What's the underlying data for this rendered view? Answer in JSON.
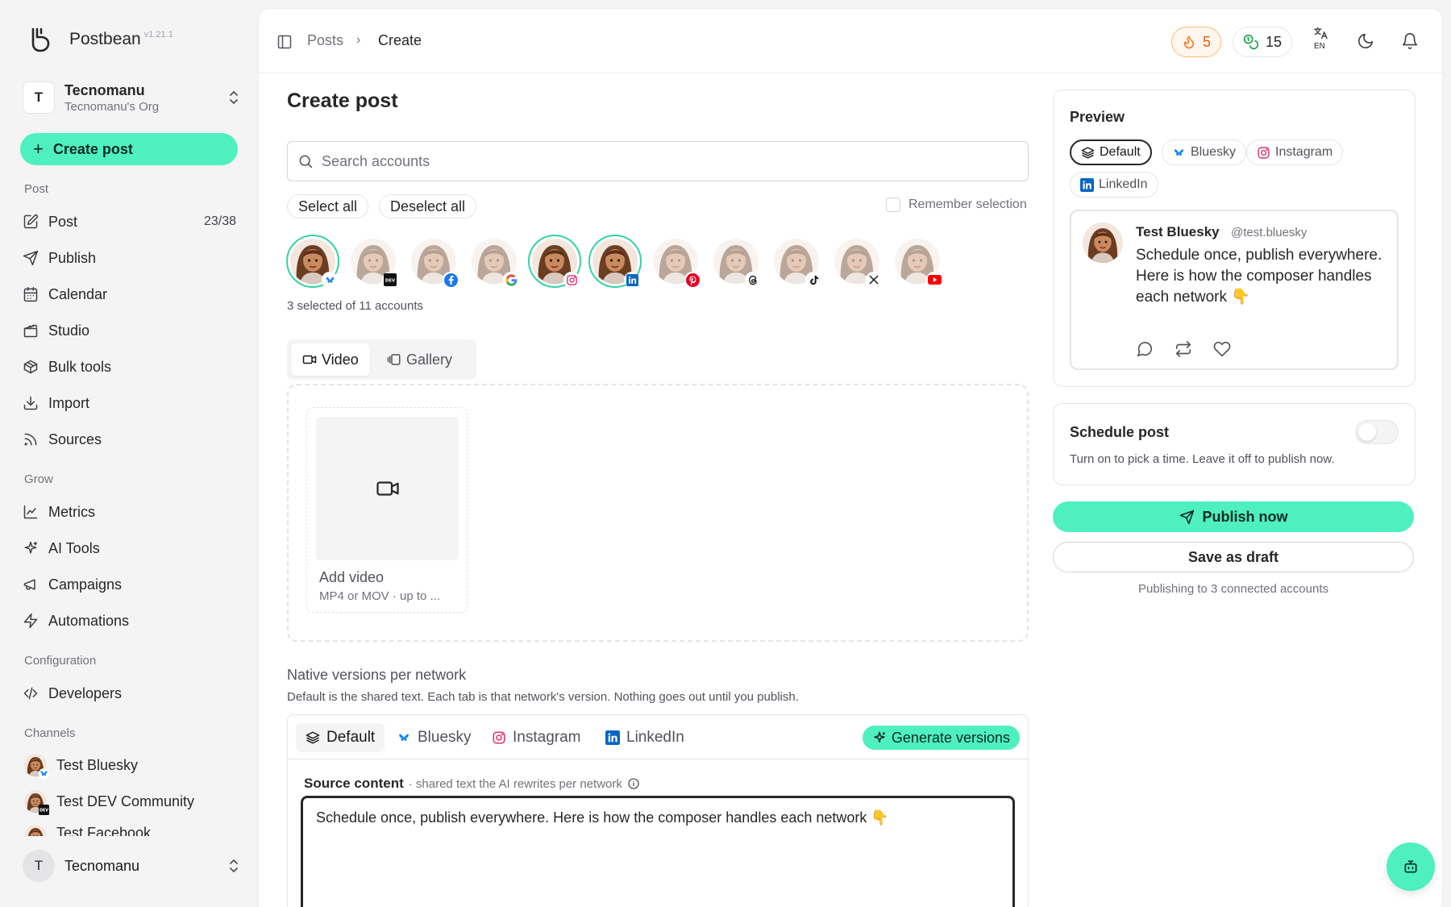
{
  "app": {
    "name": "Postbean",
    "version": "v1.21.1"
  },
  "org": {
    "initial": "T",
    "name": "Tecnomanu",
    "sub": "Tecnomanu's Org"
  },
  "sidebar": {
    "create_label": "Create post",
    "sections": {
      "post": "Post",
      "grow": "Grow",
      "configuration": "Configuration",
      "channels": "Channels"
    },
    "items": {
      "post": {
        "label": "Post",
        "count": "23/38",
        "icon": "edit-icon"
      },
      "publish": {
        "label": "Publish",
        "icon": "send-icon"
      },
      "calendar": {
        "label": "Calendar",
        "icon": "calendar-icon"
      },
      "studio": {
        "label": "Studio",
        "icon": "clapperboard-icon"
      },
      "bulk": {
        "label": "Bulk tools",
        "icon": "package-icon"
      },
      "import": {
        "label": "Import",
        "icon": "download-icon"
      },
      "sources": {
        "label": "Sources",
        "icon": "rss-icon"
      },
      "metrics": {
        "label": "Metrics",
        "icon": "chart-line-icon"
      },
      "ai": {
        "label": "AI Tools",
        "icon": "sparkles-icon"
      },
      "campaigns": {
        "label": "Campaigns",
        "icon": "megaphone-icon"
      },
      "automations": {
        "label": "Automations",
        "icon": "zap-icon"
      },
      "developers": {
        "label": "Developers",
        "icon": "code-icon"
      }
    },
    "channels": [
      {
        "name": "Test Bluesky",
        "network": "bluesky"
      },
      {
        "name": "Test DEV Community",
        "network": "dev"
      },
      {
        "name": "Test Facebook",
        "network": "facebook"
      }
    ],
    "user": {
      "initial": "T",
      "name": "Tecnomanu"
    }
  },
  "header": {
    "breadcrumb": [
      "Posts",
      "Create"
    ],
    "streak": "5",
    "credits": "15",
    "lang": "EN"
  },
  "compose": {
    "title": "Create post",
    "search_placeholder": "Search accounts",
    "select_all": "Select all",
    "deselect_all": "Deselect all",
    "remember": "Remember selection",
    "accounts": [
      {
        "network": "bluesky",
        "selected": true
      },
      {
        "network": "dev",
        "selected": false
      },
      {
        "network": "facebook",
        "selected": false
      },
      {
        "network": "google",
        "selected": false
      },
      {
        "network": "instagram",
        "selected": true
      },
      {
        "network": "linkedin",
        "selected": true
      },
      {
        "network": "pinterest",
        "selected": false
      },
      {
        "network": "threads",
        "selected": false
      },
      {
        "network": "tiktok",
        "selected": false
      },
      {
        "network": "x",
        "selected": false
      },
      {
        "network": "youtube",
        "selected": false
      }
    ],
    "selected_summary": "3 selected of 11 accounts",
    "media_tabs": {
      "video": "Video",
      "gallery": "Gallery"
    },
    "video_card": {
      "title": "Add video",
      "sub": "MP4 or MOV · up to ..."
    },
    "native": {
      "title": "Native versions per network",
      "desc": "Default is the shared text. Each tab is that network's version. Nothing goes out until you publish.",
      "tabs": [
        "Default",
        "Bluesky",
        "Instagram",
        "LinkedIn"
      ],
      "generate": "Generate versions",
      "source_label": "Source content",
      "source_hint": "· shared text the AI rewrites per network",
      "source_text": "Schedule once, publish everywhere. Here is how the composer handles each network 👇"
    }
  },
  "preview": {
    "title": "Preview",
    "tabs": [
      "Default",
      "Bluesky",
      "Instagram",
      "LinkedIn"
    ],
    "name": "Test Bluesky",
    "handle": "@test.bluesky",
    "text": "Schedule once, publish everywhere. Here is how the composer handles each network 👇"
  },
  "schedule": {
    "title": "Schedule post",
    "desc": "Turn on to pick a time. Leave it off to publish now.",
    "enabled": false
  },
  "actions": {
    "publish": "Publish now",
    "draft": "Save as draft",
    "note": "Publishing to 3 connected accounts"
  },
  "colors": {
    "accent": "#4ef0c0",
    "selected_ring": "#34d3a4",
    "streak": "#f97316",
    "credits": "#16a34a"
  }
}
